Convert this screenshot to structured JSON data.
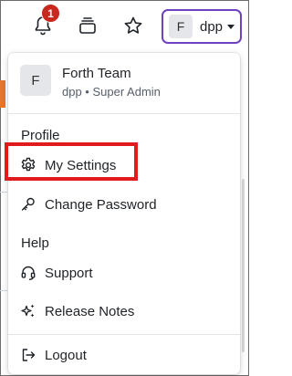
{
  "topbar": {
    "notifications": {
      "icon": "bell-icon",
      "badge_count": "1",
      "badge_color": "#c8281e"
    },
    "stack_icon": "stack-icon",
    "favorites_icon": "star-icon",
    "user_chip": {
      "avatar_initial": "F",
      "name": "dpp",
      "caret_icon": "caret-down-icon",
      "border_color": "#6f42c1"
    }
  },
  "menu": {
    "user": {
      "avatar_initial": "F",
      "name": "Forth Team",
      "role": "dpp • Super Admin"
    },
    "sections": [
      {
        "label": "Profile",
        "items": [
          {
            "label": "My Settings",
            "icon": "gear-icon"
          },
          {
            "label": "Change Password",
            "icon": "key-icon"
          }
        ]
      },
      {
        "label": "Help",
        "items": [
          {
            "label": "Support",
            "icon": "headset-icon"
          },
          {
            "label": "Release Notes",
            "icon": "sparkles-icon"
          }
        ]
      }
    ],
    "logout": {
      "label": "Logout",
      "icon": "logout-icon"
    }
  },
  "annotation": {
    "highlight_color": "#e2191d"
  }
}
